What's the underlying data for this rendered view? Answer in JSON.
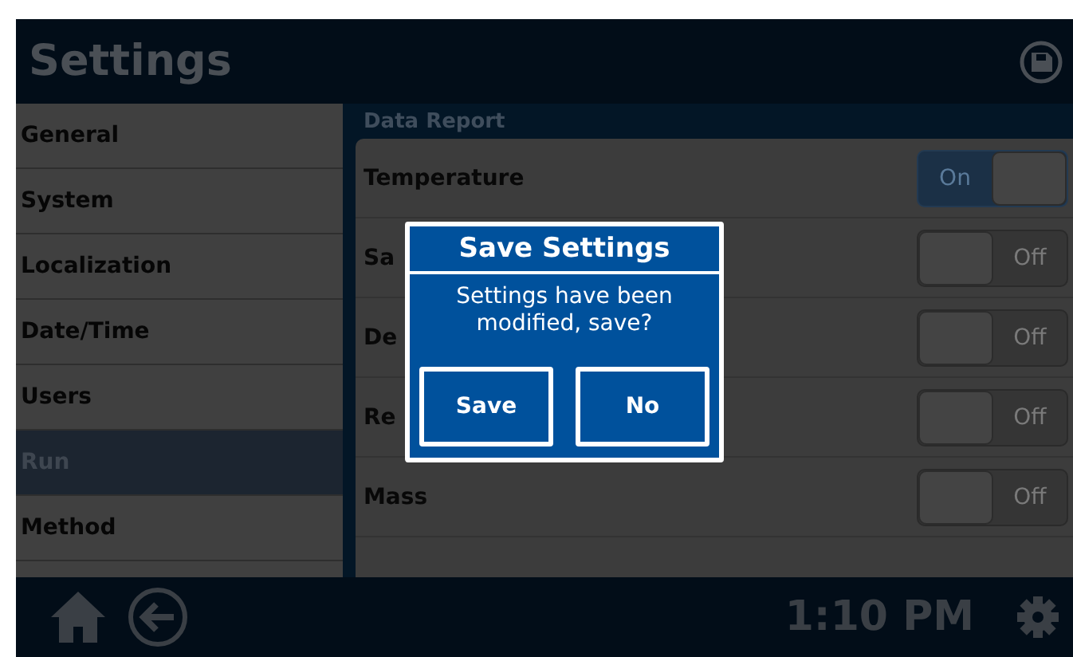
{
  "header": {
    "title": "Settings"
  },
  "sidebar": {
    "items": [
      {
        "label": "General",
        "selected": false
      },
      {
        "label": "System",
        "selected": false
      },
      {
        "label": "Localization",
        "selected": false
      },
      {
        "label": "Date/Time",
        "selected": false
      },
      {
        "label": "Users",
        "selected": false
      },
      {
        "label": "Run",
        "selected": true
      },
      {
        "label": "Method",
        "selected": false
      }
    ]
  },
  "section": {
    "title": "Data Report",
    "rows": [
      {
        "label": "Temperature",
        "toggle": {
          "label": "On",
          "on": true
        }
      },
      {
        "label": "Sa",
        "toggle": {
          "label": "Off",
          "on": false
        }
      },
      {
        "label": "De",
        "toggle": {
          "label": "Off",
          "on": false
        }
      },
      {
        "label": "Re",
        "toggle": {
          "label": "Off",
          "on": false
        }
      },
      {
        "label": "Mass",
        "toggle": {
          "label": "Off",
          "on": false
        }
      }
    ]
  },
  "dialog": {
    "title": "Save Settings",
    "message": "Settings have been modified, save?",
    "buttons": [
      "Save",
      "No"
    ]
  },
  "footer": {
    "time": "1:10 PM"
  }
}
